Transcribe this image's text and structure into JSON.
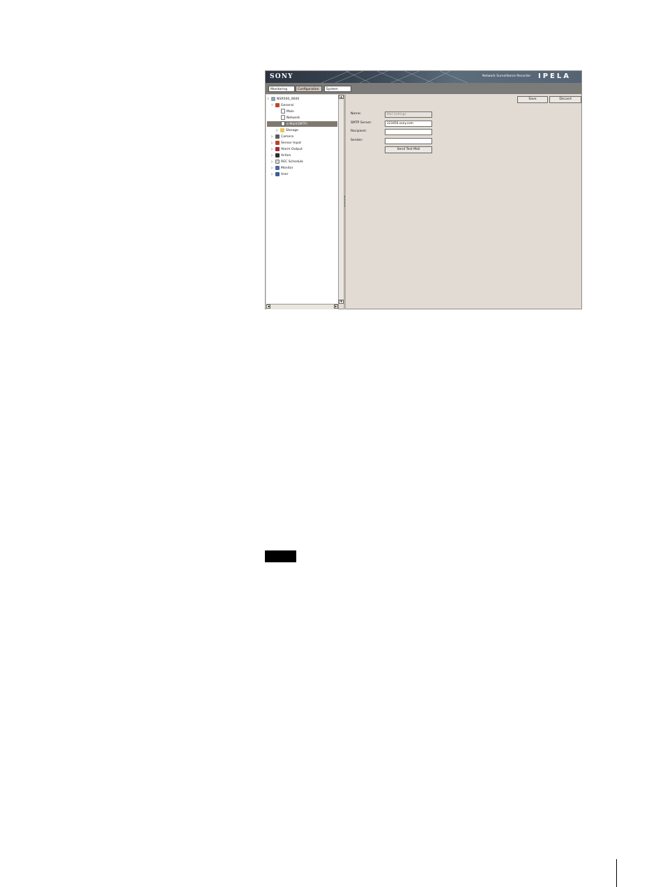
{
  "banner": {
    "brand": "SONY",
    "product": "Network Surveillance Recorder",
    "logo": "IPELA"
  },
  "tabs": [
    {
      "label": "Monitoring"
    },
    {
      "label": "Configuration"
    },
    {
      "label": "System"
    }
  ],
  "tree": {
    "root": "NSR500_0600",
    "items": [
      {
        "label": "General"
      },
      {
        "label": "Main"
      },
      {
        "label": "Network"
      },
      {
        "label": "e-Mail(SMTP)"
      },
      {
        "label": "Storage"
      },
      {
        "label": "Camera"
      },
      {
        "label": "Sensor Input"
      },
      {
        "label": "Alarm Output"
      },
      {
        "label": "Action"
      },
      {
        "label": "REC Schedule"
      },
      {
        "label": "Monitor"
      },
      {
        "label": "User"
      }
    ]
  },
  "toolbar": {
    "save_label": "Save",
    "discard_label": "Discard"
  },
  "form": {
    "name_label": "Name:",
    "name_value": "Mail Settings",
    "smtp_label": "SMTP Server:",
    "smtp_value": "123456.sony.com",
    "recipient_label": "Recipient:",
    "recipient_value": "",
    "sender_label": "Sender:",
    "sender_value": "",
    "test_button": "Send Test Mail"
  },
  "colors": {
    "selected_row": "#7f796f",
    "panel_bg": "#e1dbd4",
    "tab_bar": "#7b7b79"
  }
}
